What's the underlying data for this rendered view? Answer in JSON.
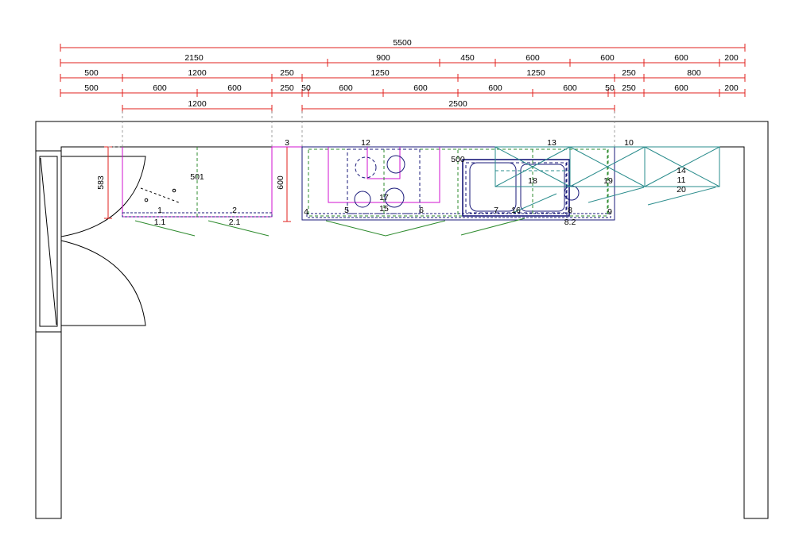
{
  "colors": {
    "dim": "#e0201c",
    "wall": "#000000",
    "base_cabinet": "#1a1a7a",
    "tall_unit": "#d010d0",
    "wall_unit": "#2a8c8c",
    "door_swing": "#2e8b2e"
  },
  "dimensions": {
    "overall": "5500",
    "row2": [
      "2150",
      "900",
      "450",
      "600",
      "600",
      "600",
      "200"
    ],
    "row3": [
      "500",
      "1200",
      "250",
      "1250",
      "1250",
      "250",
      "800"
    ],
    "row4": [
      "500",
      "600",
      "600",
      "250",
      "50",
      "600",
      "600",
      "600",
      "600",
      "50",
      "250",
      "600",
      "200"
    ],
    "row5": [
      "1200",
      "2500"
    ],
    "depth_left": "583",
    "depth_right": "600"
  },
  "labels": {
    "l1": "1",
    "l1_1": "1.1",
    "l2": "2",
    "l2_1": "2.1",
    "l3": "3",
    "l4": "4",
    "l5": "5",
    "l6": "6",
    "l7": "7",
    "l8": "8",
    "l8_2": "8.2",
    "l9": "9",
    "l10": "10",
    "l12": "12",
    "l13": "13",
    "l14": "14",
    "l11": "11",
    "l15": "15",
    "l16": "16",
    "l17": "17",
    "l18": "18",
    "l19": "19",
    "l20": "20",
    "l500": "500",
    "l501": "501"
  }
}
